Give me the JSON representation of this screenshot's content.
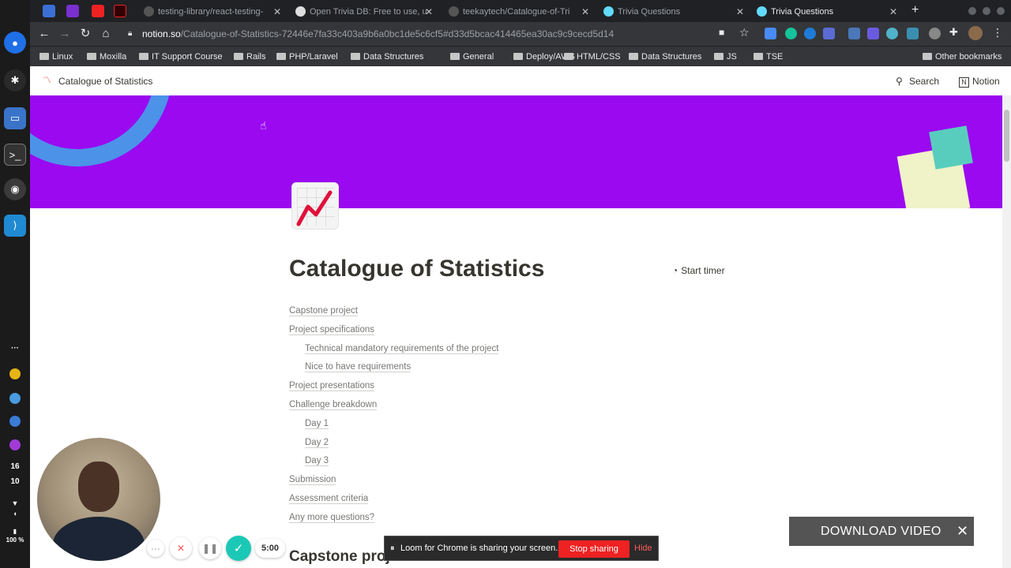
{
  "dock": {
    "clock_hour": "16",
    "clock_minute": "10",
    "battery": "100 %"
  },
  "tabs": [
    {
      "title": "testing-library/react-testing-"
    },
    {
      "title": "Open Trivia DB: Free to use, u"
    },
    {
      "title": "teekaytech/Catalogue-of-Tri"
    },
    {
      "title": "Trivia Questions"
    },
    {
      "title": "Trivia Questions"
    }
  ],
  "address": {
    "host": "notion.so",
    "path": "/Catalogue-of-Statistics-72446e7fa33c403a9b6a0bc1de5c6cf5#d33d5bcac414465ea30ac9c9cecd5d14"
  },
  "bookmarks": [
    "Linux",
    "Moxilla",
    "IT Support Course",
    "Rails",
    "PHP/Laravel",
    "Data Structures",
    "General",
    "Deploy/AWS",
    "HTML/CSS",
    "Data Structures",
    "JS",
    "TSE"
  ],
  "other_bookmarks": "Other bookmarks",
  "notion": {
    "breadcrumb_title": "Catalogue of Statistics",
    "search_label": "Search",
    "notion_label": "Notion"
  },
  "page": {
    "title": "Catalogue of Statistics",
    "start_timer": "Start timer",
    "toc": [
      {
        "label": "Capstone project",
        "level": 1
      },
      {
        "label": "Project specifications",
        "level": 1
      },
      {
        "label": "Technical mandatory requirements of the project",
        "level": 2
      },
      {
        "label": "Nice to have requirements",
        "level": 2
      },
      {
        "label": "Project presentations",
        "level": 1
      },
      {
        "label": "Challenge breakdown",
        "level": 1
      },
      {
        "label": "Day 1",
        "level": 2
      },
      {
        "label": "Day 2",
        "level": 2
      },
      {
        "label": "Day 3",
        "level": 2
      },
      {
        "label": "Submission",
        "level": 1
      },
      {
        "label": "Assessment criteria",
        "level": 1
      },
      {
        "label": "Any more questions?",
        "level": 1
      }
    ],
    "section_heading": "Capstone project"
  },
  "loom": {
    "timer": "5:00",
    "share_text": "Loom for Chrome is sharing your screen.",
    "stop_sharing": "Stop sharing",
    "hide": "Hide"
  },
  "download": {
    "label": "DOWNLOAD VIDEO"
  },
  "colors": {
    "cover": "#9a09f0",
    "accent_teal": "#1bc8b6",
    "stop_red": "#ee2222"
  }
}
